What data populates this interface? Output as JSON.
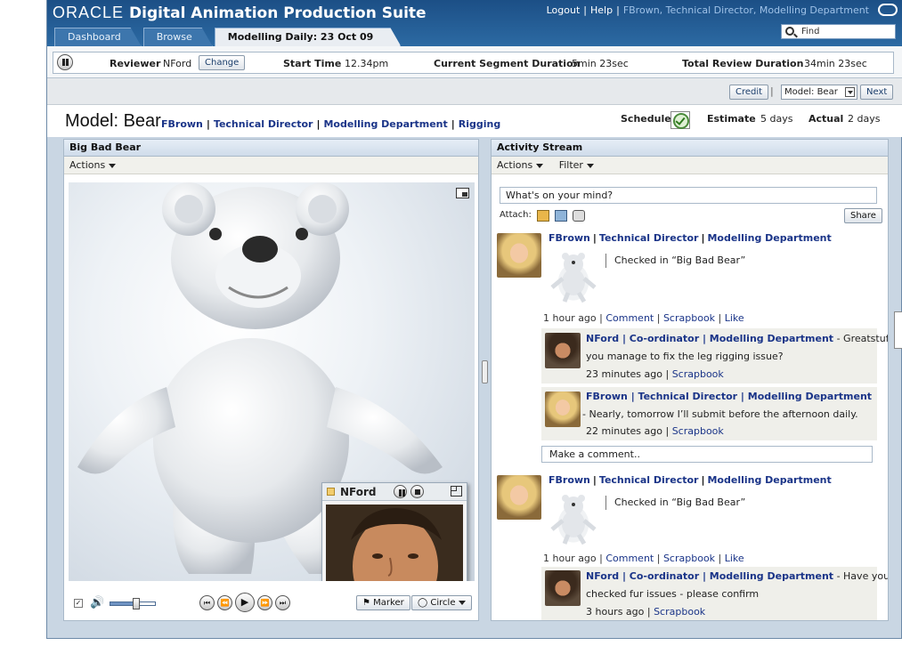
{
  "header": {
    "brand_oracle": "ORACLE",
    "app_title": "Digital Animation Production Suite",
    "logout": "Logout",
    "help": "Help",
    "user_info": "FBrown, Technical Director, Modelling Department",
    "find_label": "Find",
    "tabs": [
      {
        "label": "Dashboard"
      },
      {
        "label": "Browse"
      },
      {
        "label": "Modelling Daily: 23 Oct 09"
      }
    ]
  },
  "review": {
    "reviewer_label": "Reviewer",
    "reviewer_value": "NFord",
    "change_button": "Change",
    "start_time_label": "Start Time",
    "start_time_value": "12.34pm",
    "segment_label": "Current Segment Duration",
    "segment_value": "5min 23sec",
    "total_label": "Total Review Duration",
    "total_value": "34min 23sec"
  },
  "subbar": {
    "credit_button": "Credit",
    "model_select": "Model: Bear",
    "next_button": "Next"
  },
  "model": {
    "title": "Model: Bear",
    "links": [
      "FBrown",
      "Technical Director",
      "Modelling Department",
      "Rigging"
    ],
    "schedule_label": "Schedule",
    "estimate_label": "Estimate",
    "estimate_value": "5 days",
    "actual_label": "Actual",
    "actual_value": "2 days"
  },
  "left_panel": {
    "title": "Big Bad Bear",
    "actions": "Actions",
    "video_call_name": "NFord",
    "marker_button": "Marker",
    "circle_button": "Circle",
    "volume_level": 0.55,
    "colors": {
      "bear": "#eef0f2",
      "nose": "#2a2a2a"
    }
  },
  "activity": {
    "title": "Activity Stream",
    "actions": "Actions",
    "filter": "Filter",
    "status_placeholder": "What's on your mind?",
    "attach_label": "Attach:",
    "share_button": "Share",
    "comment_placeholder": "Make a comment..",
    "posts": [
      {
        "author": [
          "FBrown",
          "Technical Director",
          "Modelling Department"
        ],
        "body": "Checked in “Big Bad Bear”",
        "time": "1 hour ago",
        "links": [
          "Comment",
          "Scrapbook",
          "Like"
        ],
        "comments": [
          {
            "author": "NFord | Co-ordinator | Modelling Department",
            "text_line1": " - Greatstuff, did",
            "text_line2": "you manage to fix the leg rigging issue?",
            "time": "23 minutes ago",
            "link": "Scrapbook"
          },
          {
            "author": "FBrown | Technical Director | Modelling Department",
            "text_line1": "",
            "text_line2": "- Nearly, tomorrow I’ll submit before the afternoon daily.",
            "time": "22 minutes ago",
            "link": "Scrapbook"
          }
        ]
      },
      {
        "author": [
          "FBrown",
          "Technical Director",
          "Modelling Department"
        ],
        "body": "Checked in “Big Bad Bear”",
        "time": "1 hour ago",
        "links": [
          "Comment",
          "Scrapbook",
          "Like"
        ],
        "comments": [
          {
            "author": "NFord | Co-ordinator | Modelling Department",
            "text_line1": " - Have you",
            "text_line2": "checked fur issues - please confirm",
            "time": "3 hours ago",
            "link": "Scrapbook"
          }
        ]
      }
    ]
  }
}
